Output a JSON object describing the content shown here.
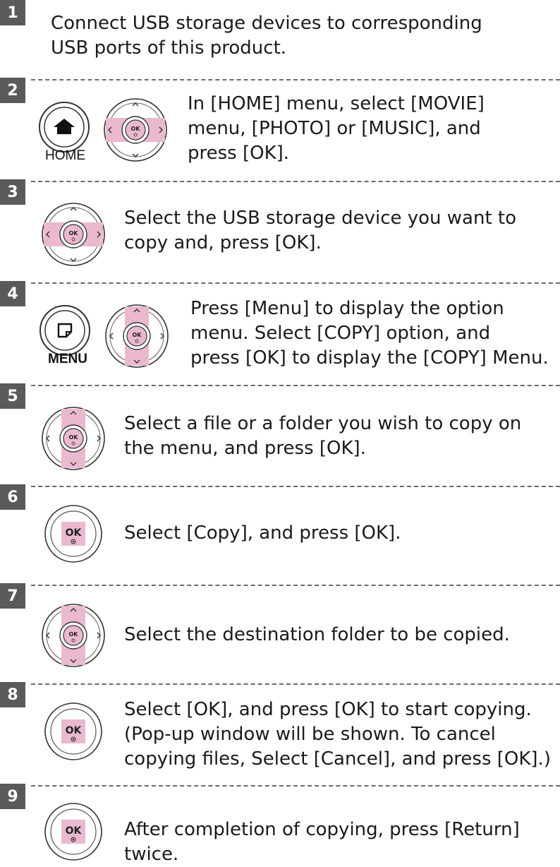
{
  "steps": [
    {
      "number": "1",
      "lines": [
        "Connect USB storage devices to corresponding",
        "USB ports of this product."
      ]
    },
    {
      "number": "2",
      "lines": [
        "In [HOME] menu, select [MOVIE]",
        "menu, [PHOTO] or [MUSIC], and",
        "press [OK]."
      ],
      "button_label": "HOME"
    },
    {
      "number": "3",
      "lines": [
        "Select the USB storage device you want to",
        "copy and, press [OK]."
      ]
    },
    {
      "number": "4",
      "lines": [
        "Press [Menu] to display the option",
        "menu. Select [COPY] option, and",
        "press [OK] to display the [COPY] Menu."
      ],
      "button_label": "MENU"
    },
    {
      "number": "5",
      "lines": [
        "Select a file or a folder you wish to copy on",
        "the menu, and press [OK]."
      ]
    },
    {
      "number": "6",
      "lines": [
        "Select [Copy], and press [OK]."
      ]
    },
    {
      "number": "7",
      "lines": [
        "Select the destination folder to be copied."
      ]
    },
    {
      "number": "8",
      "lines": [
        "Select [OK], and press [OK] to start copying.",
        "(Pop-up window will be shown. To cancel",
        "copying files, Select [Cancel], and press [OK].)"
      ]
    },
    {
      "number": "9",
      "lines": [
        "After completion of copying, press [Return] twice."
      ]
    }
  ],
  "ok_label": "OK",
  "colors": {
    "highlight": "#eab9cf",
    "step_badge": "#5a5a5a",
    "dash": "#6a6a6a"
  },
  "icons": [
    "home-icon",
    "menu-icon",
    "ok-button-icon",
    "navigation-pad-icon"
  ]
}
